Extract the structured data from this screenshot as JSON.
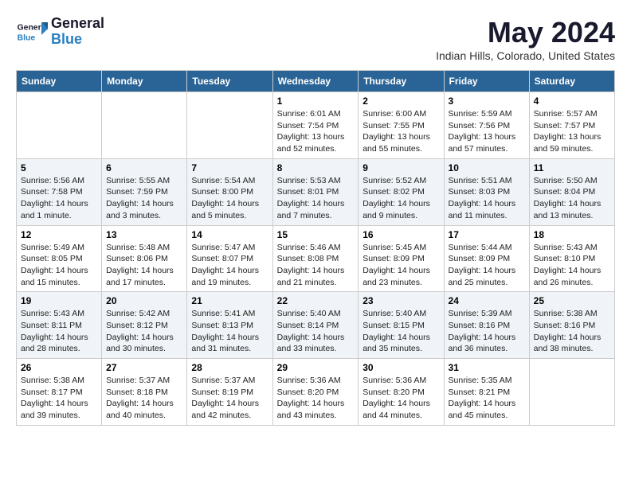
{
  "logo": {
    "line1": "General",
    "line2": "Blue"
  },
  "title": "May 2024",
  "subtitle": "Indian Hills, Colorado, United States",
  "days_header": [
    "Sunday",
    "Monday",
    "Tuesday",
    "Wednesday",
    "Thursday",
    "Friday",
    "Saturday"
  ],
  "weeks": [
    [
      {
        "day": "",
        "info": ""
      },
      {
        "day": "",
        "info": ""
      },
      {
        "day": "",
        "info": ""
      },
      {
        "day": "1",
        "info": "Sunrise: 6:01 AM\nSunset: 7:54 PM\nDaylight: 13 hours\nand 52 minutes."
      },
      {
        "day": "2",
        "info": "Sunrise: 6:00 AM\nSunset: 7:55 PM\nDaylight: 13 hours\nand 55 minutes."
      },
      {
        "day": "3",
        "info": "Sunrise: 5:59 AM\nSunset: 7:56 PM\nDaylight: 13 hours\nand 57 minutes."
      },
      {
        "day": "4",
        "info": "Sunrise: 5:57 AM\nSunset: 7:57 PM\nDaylight: 13 hours\nand 59 minutes."
      }
    ],
    [
      {
        "day": "5",
        "info": "Sunrise: 5:56 AM\nSunset: 7:58 PM\nDaylight: 14 hours\nand 1 minute."
      },
      {
        "day": "6",
        "info": "Sunrise: 5:55 AM\nSunset: 7:59 PM\nDaylight: 14 hours\nand 3 minutes."
      },
      {
        "day": "7",
        "info": "Sunrise: 5:54 AM\nSunset: 8:00 PM\nDaylight: 14 hours\nand 5 minutes."
      },
      {
        "day": "8",
        "info": "Sunrise: 5:53 AM\nSunset: 8:01 PM\nDaylight: 14 hours\nand 7 minutes."
      },
      {
        "day": "9",
        "info": "Sunrise: 5:52 AM\nSunset: 8:02 PM\nDaylight: 14 hours\nand 9 minutes."
      },
      {
        "day": "10",
        "info": "Sunrise: 5:51 AM\nSunset: 8:03 PM\nDaylight: 14 hours\nand 11 minutes."
      },
      {
        "day": "11",
        "info": "Sunrise: 5:50 AM\nSunset: 8:04 PM\nDaylight: 14 hours\nand 13 minutes."
      }
    ],
    [
      {
        "day": "12",
        "info": "Sunrise: 5:49 AM\nSunset: 8:05 PM\nDaylight: 14 hours\nand 15 minutes."
      },
      {
        "day": "13",
        "info": "Sunrise: 5:48 AM\nSunset: 8:06 PM\nDaylight: 14 hours\nand 17 minutes."
      },
      {
        "day": "14",
        "info": "Sunrise: 5:47 AM\nSunset: 8:07 PM\nDaylight: 14 hours\nand 19 minutes."
      },
      {
        "day": "15",
        "info": "Sunrise: 5:46 AM\nSunset: 8:08 PM\nDaylight: 14 hours\nand 21 minutes."
      },
      {
        "day": "16",
        "info": "Sunrise: 5:45 AM\nSunset: 8:09 PM\nDaylight: 14 hours\nand 23 minutes."
      },
      {
        "day": "17",
        "info": "Sunrise: 5:44 AM\nSunset: 8:09 PM\nDaylight: 14 hours\nand 25 minutes."
      },
      {
        "day": "18",
        "info": "Sunrise: 5:43 AM\nSunset: 8:10 PM\nDaylight: 14 hours\nand 26 minutes."
      }
    ],
    [
      {
        "day": "19",
        "info": "Sunrise: 5:43 AM\nSunset: 8:11 PM\nDaylight: 14 hours\nand 28 minutes."
      },
      {
        "day": "20",
        "info": "Sunrise: 5:42 AM\nSunset: 8:12 PM\nDaylight: 14 hours\nand 30 minutes."
      },
      {
        "day": "21",
        "info": "Sunrise: 5:41 AM\nSunset: 8:13 PM\nDaylight: 14 hours\nand 31 minutes."
      },
      {
        "day": "22",
        "info": "Sunrise: 5:40 AM\nSunset: 8:14 PM\nDaylight: 14 hours\nand 33 minutes."
      },
      {
        "day": "23",
        "info": "Sunrise: 5:40 AM\nSunset: 8:15 PM\nDaylight: 14 hours\nand 35 minutes."
      },
      {
        "day": "24",
        "info": "Sunrise: 5:39 AM\nSunset: 8:16 PM\nDaylight: 14 hours\nand 36 minutes."
      },
      {
        "day": "25",
        "info": "Sunrise: 5:38 AM\nSunset: 8:16 PM\nDaylight: 14 hours\nand 38 minutes."
      }
    ],
    [
      {
        "day": "26",
        "info": "Sunrise: 5:38 AM\nSunset: 8:17 PM\nDaylight: 14 hours\nand 39 minutes."
      },
      {
        "day": "27",
        "info": "Sunrise: 5:37 AM\nSunset: 8:18 PM\nDaylight: 14 hours\nand 40 minutes."
      },
      {
        "day": "28",
        "info": "Sunrise: 5:37 AM\nSunset: 8:19 PM\nDaylight: 14 hours\nand 42 minutes."
      },
      {
        "day": "29",
        "info": "Sunrise: 5:36 AM\nSunset: 8:20 PM\nDaylight: 14 hours\nand 43 minutes."
      },
      {
        "day": "30",
        "info": "Sunrise: 5:36 AM\nSunset: 8:20 PM\nDaylight: 14 hours\nand 44 minutes."
      },
      {
        "day": "31",
        "info": "Sunrise: 5:35 AM\nSunset: 8:21 PM\nDaylight: 14 hours\nand 45 minutes."
      },
      {
        "day": "",
        "info": ""
      }
    ]
  ]
}
